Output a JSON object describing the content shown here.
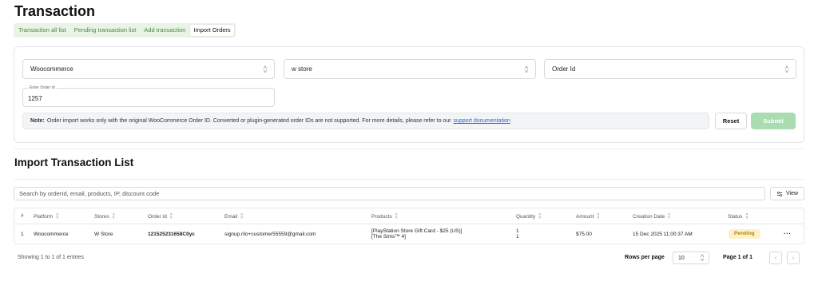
{
  "page": {
    "title": "Transaction"
  },
  "tabs": [
    {
      "label": "Transaction all list"
    },
    {
      "label": "Pending transaction list"
    },
    {
      "label": "Add transaction"
    },
    {
      "label": "Import Orders",
      "active": true
    }
  ],
  "form": {
    "platform": {
      "value": "Woocommerce"
    },
    "store": {
      "value": "w store"
    },
    "import_by": {
      "value": "Order Id"
    },
    "order_id": {
      "label": "Enter Order Id",
      "value": "1257"
    },
    "note": {
      "prefix": "Note:",
      "text": "Order import works only with the original WooCommerce Order ID. Converted or plugin-generated order IDs are not supported. For more details, please refer to our",
      "link": "support documentation"
    },
    "reset_label": "Reset",
    "submit_label": "Submit"
  },
  "list": {
    "title": "Import Transaction List",
    "search_placeholder": "Search by orderId, email, products, IP, discount code",
    "view_label": "View",
    "columns": [
      "#",
      "Platform",
      "Stores",
      "Order Id",
      "Email",
      "Products",
      "Quantity",
      "Amount",
      "Creation Date",
      "Status"
    ],
    "rows": [
      {
        "index": "1",
        "platform": "Woocommerce",
        "store": "W Store",
        "order_id": "121525231658C0yc",
        "email": "signup.rilo+customer55559@gmail.com",
        "products": [
          "[PlayStation Store Gift Card - $25 (US)]",
          "[The Sims™ 4]"
        ],
        "quantity": [
          "1",
          "1"
        ],
        "amount": "$75.00",
        "created": "15 Dec 2025 11:00:37 AM",
        "status": "Pending",
        "more": "···"
      }
    ]
  },
  "pagination": {
    "entries_text": "Showing 1 to 1 of 1 entries",
    "rows_per_page_label": "Rows per page",
    "rows_per_page_value": "10",
    "page_text": "Page 1 of 1",
    "prev": "‹",
    "next": "›"
  },
  "colors": {
    "accent": "#4a8a3e",
    "submit_disabled": "#a9dcb1",
    "pending_bg": "#fdf1cc",
    "pending_text": "#b8860b",
    "link": "#2b5fd9"
  }
}
